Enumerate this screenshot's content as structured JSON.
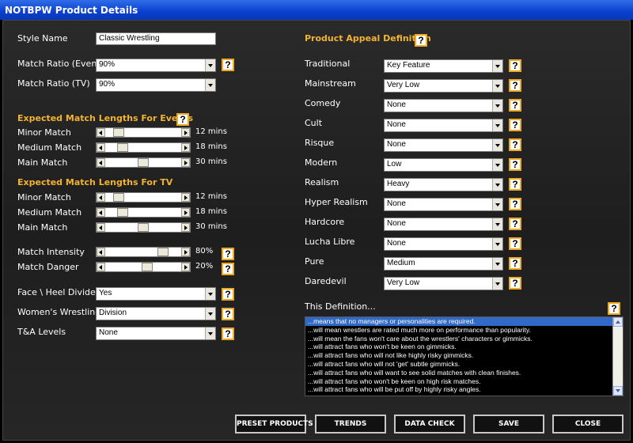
{
  "window": {
    "title": "NOTBPW Product Details"
  },
  "style_name": {
    "label": "Style Name",
    "value": "Classic Wrestling"
  },
  "match_ratio_event": {
    "label": "Match Ratio (Event)",
    "value": "90%"
  },
  "match_ratio_tv": {
    "label": "Match Ratio (TV)",
    "value": "90%"
  },
  "help_glyph": "?",
  "events_lengths": {
    "header": "Expected Match Lengths For Events",
    "rows": [
      {
        "label": "Minor Match",
        "value": "12 mins",
        "level": 0.12
      },
      {
        "label": "Medium Match",
        "value": "18 mins",
        "level": 0.18
      },
      {
        "label": "Main Match",
        "value": "30 mins",
        "level": 0.5
      }
    ]
  },
  "tv_lengths": {
    "header": "Expected Match Lengths For TV",
    "rows": [
      {
        "label": "Minor Match",
        "value": "12 mins",
        "level": 0.12
      },
      {
        "label": "Medium Match",
        "value": "18 mins",
        "level": 0.18
      },
      {
        "label": "Main Match",
        "value": "30 mins",
        "level": 0.5
      }
    ]
  },
  "intensity": {
    "label": "Match Intensity",
    "value": "80%",
    "level": 0.8
  },
  "danger": {
    "label": "Match Danger",
    "value": "20%",
    "level": 0.56
  },
  "face_heel": {
    "label": "Face \\ Heel Divide",
    "value": "Yes"
  },
  "womens": {
    "label": "Women's Wrestling",
    "value": "Division"
  },
  "ta": {
    "label": "T&A Levels",
    "value": "None"
  },
  "appeal": {
    "header": "Product Appeal Definition",
    "rows": [
      {
        "label": "Traditional",
        "value": "Key Feature"
      },
      {
        "label": "Mainstream",
        "value": "Very Low"
      },
      {
        "label": "Comedy",
        "value": "None"
      },
      {
        "label": "Cult",
        "value": "None"
      },
      {
        "label": "Risque",
        "value": "None"
      },
      {
        "label": "Modern",
        "value": "Low"
      },
      {
        "label": "Realism",
        "value": "Heavy"
      },
      {
        "label": "Hyper Realism",
        "value": "None"
      },
      {
        "label": "Hardcore",
        "value": "None"
      },
      {
        "label": "Lucha Libre",
        "value": "None"
      },
      {
        "label": "Pure",
        "value": "Medium"
      },
      {
        "label": "Daredevil",
        "value": "Very Low"
      }
    ]
  },
  "definition": {
    "header": "This Definition...",
    "lines": [
      "...means that no managers or personalities are required.",
      "...will mean wrestlers are rated much more on performance than popularity.",
      "...will mean the fans won't care about the wrestlers' characters or gimmicks.",
      "...will attract fans who won't be keen on gimmicks.",
      "...will attract fans who will not like highly risky gimmicks.",
      "...will attract fans who will not 'get' subtle gimmicks.",
      "...will attract fans who will want to see solid matches with clean finishes.",
      "...will attract fans who won't be keen on high risk matches.",
      "...will attract fans who will be put off by highly risky angles."
    ]
  },
  "buttons": {
    "preset": "PRESET PRODUCTS",
    "trends": "TRENDS",
    "data_check": "DATA CHECK",
    "save": "SAVE",
    "close": "CLOSE"
  },
  "colors": {
    "header": "#f2b331",
    "selection": "#3169c6",
    "titlebar": "#0a3fcf"
  }
}
